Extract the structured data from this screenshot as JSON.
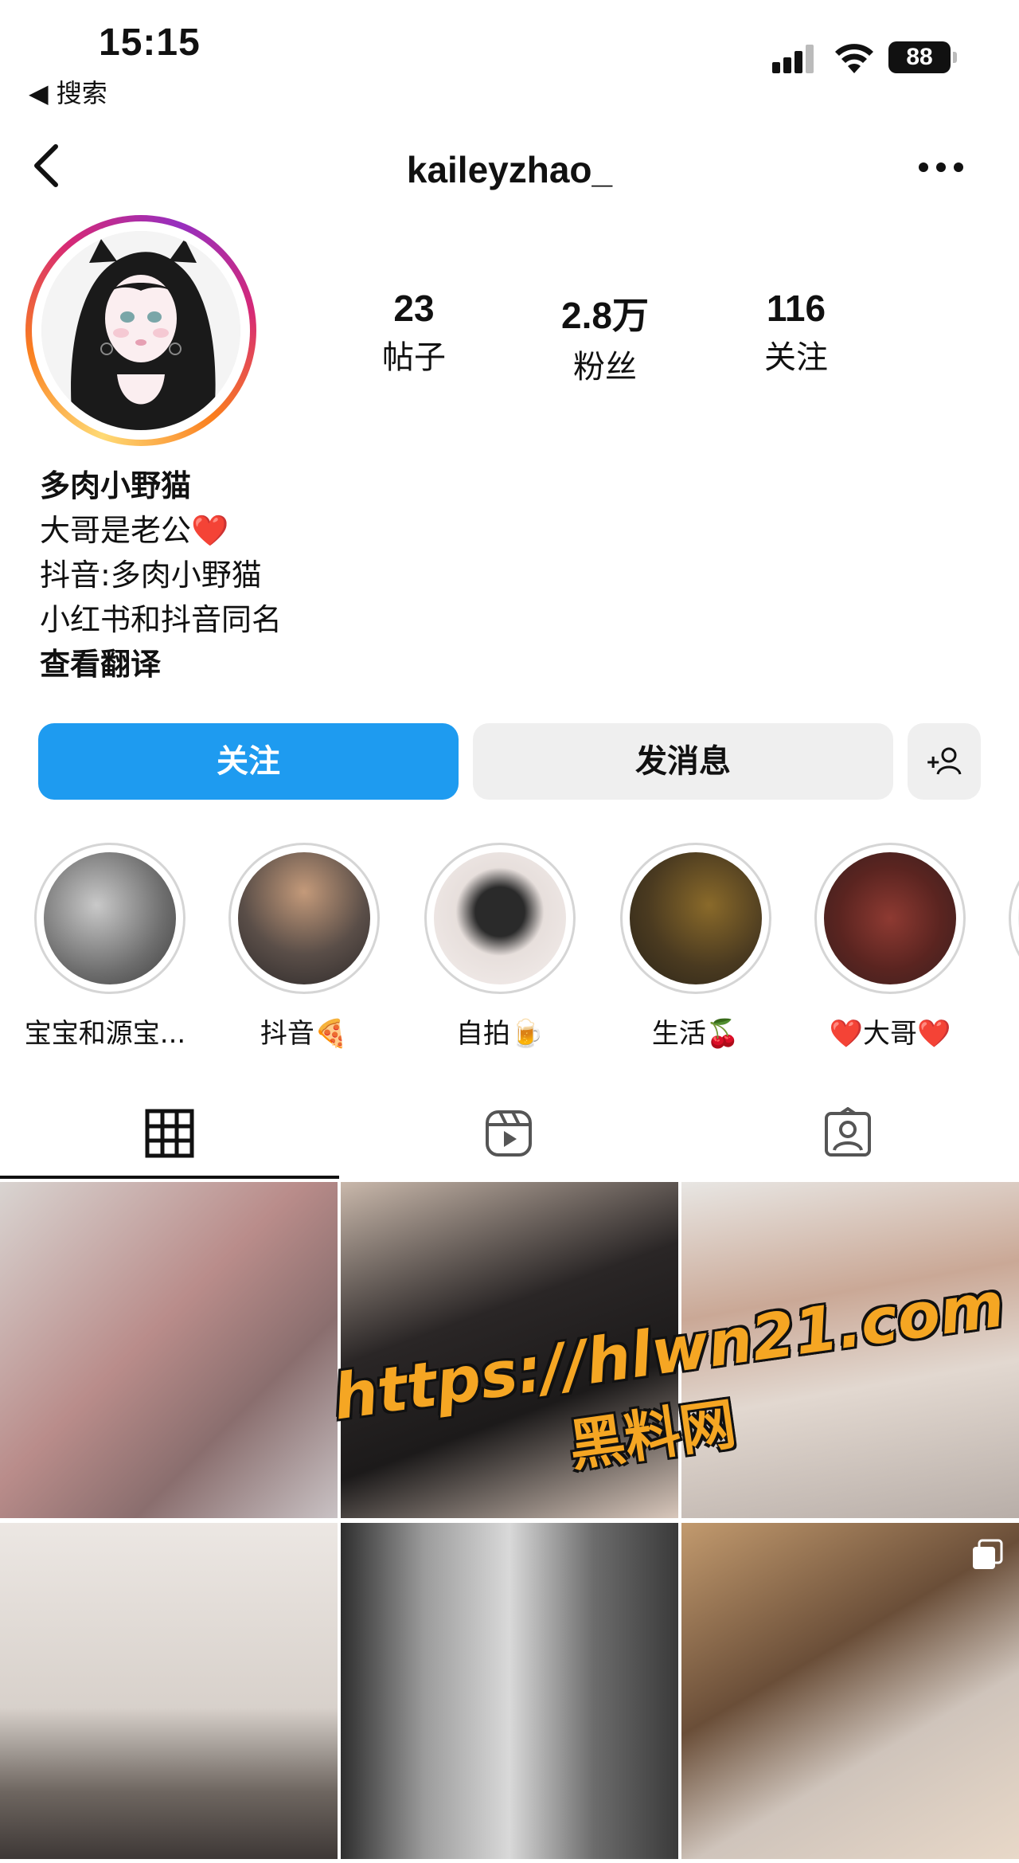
{
  "status_bar": {
    "time": "15:15",
    "back_label": "◀ 搜索",
    "battery": "88"
  },
  "nav": {
    "username": "kaileyzhao_"
  },
  "profile": {
    "stats": [
      {
        "value": "23",
        "label": "帖子"
      },
      {
        "value": "2.8万",
        "label": "粉丝"
      },
      {
        "value": "116",
        "label": "关注"
      }
    ],
    "name": "多肉小野猫",
    "bio_lines": [
      "大哥是老公",
      "抖音:多肉小野猫",
      "小红书和抖音同名"
    ],
    "bio_heart": "❤️",
    "translate_label": "查看翻译"
  },
  "buttons": {
    "follow": "关注",
    "message": "发消息",
    "add_person": "+"
  },
  "highlights": [
    {
      "caption": "宝宝和源宝..."
    },
    {
      "caption": "抖音🍕"
    },
    {
      "caption": "自拍🍺"
    },
    {
      "caption": "生活🍒"
    },
    {
      "caption": "❤️大哥❤️"
    }
  ],
  "tabs": [
    "grid-icon",
    "reels-icon",
    "tagged-icon"
  ],
  "watermark": {
    "line1": "https://hlwn21.com",
    "line2": "黑料网"
  },
  "colors": {
    "follow_button": "#1e9bf0",
    "secondary_button": "#efefef"
  }
}
